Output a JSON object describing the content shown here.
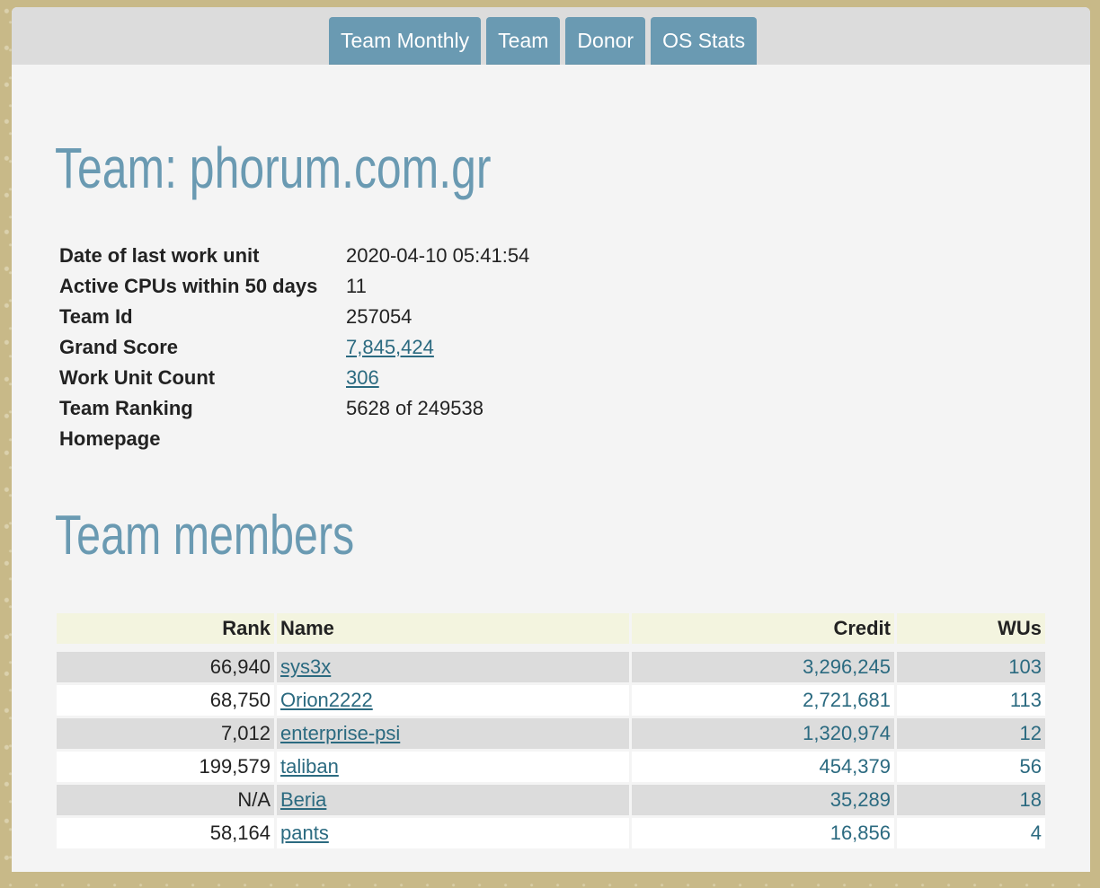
{
  "nav": {
    "tabs": [
      "Team Monthly",
      "Team",
      "Donor",
      "OS Stats"
    ]
  },
  "page_title": "Team: phorum.com.gr",
  "info": [
    {
      "label": "Date of last work unit",
      "value": "2020-04-10 05:41:54",
      "link": false
    },
    {
      "label": "Active CPUs within 50 days",
      "value": "11",
      "link": false
    },
    {
      "label": "Team Id",
      "value": "257054",
      "link": false
    },
    {
      "label": "Grand Score",
      "value": "7,845,424",
      "link": true
    },
    {
      "label": "Work Unit Count",
      "value": "306",
      "link": true
    },
    {
      "label": "Team Ranking",
      "value": "5628 of 249538",
      "link": false
    },
    {
      "label": "Homepage",
      "value": "",
      "link": false
    }
  ],
  "members_title": "Team members",
  "members": {
    "headers": {
      "rank": "Rank",
      "name": "Name",
      "credit": "Credit",
      "wus": "WUs"
    },
    "rows": [
      {
        "rank": "66,940",
        "name": "sys3x",
        "credit": "3,296,245",
        "wus": "103"
      },
      {
        "rank": "68,750",
        "name": "Orion2222",
        "credit": "2,721,681",
        "wus": "113"
      },
      {
        "rank": "7,012",
        "name": "enterprise-psi",
        "credit": "1,320,974",
        "wus": "12"
      },
      {
        "rank": "199,579",
        "name": "taliban",
        "credit": "454,379",
        "wus": "56"
      },
      {
        "rank": "N/A",
        "name": "Beria",
        "credit": "35,289",
        "wus": "18"
      },
      {
        "rank": "58,164",
        "name": "pants",
        "credit": "16,856",
        "wus": "4"
      }
    ]
  },
  "colors": {
    "accent": "#6a9ab2",
    "link": "#2b6a80",
    "header_row": "#f3f4df"
  }
}
